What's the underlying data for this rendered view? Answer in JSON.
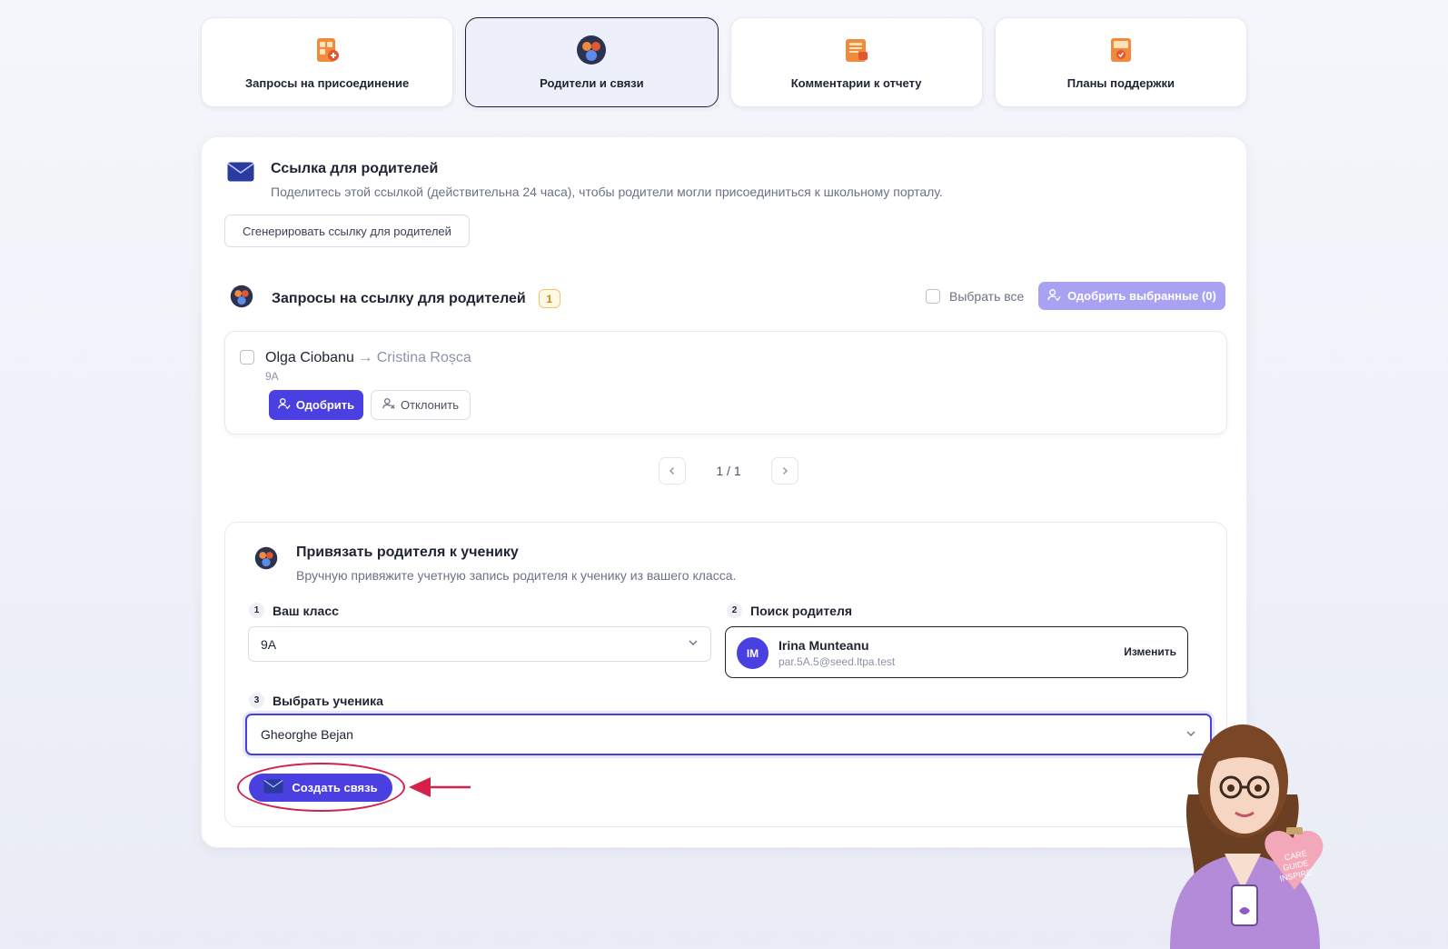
{
  "tabs": [
    {
      "label": "Запросы на присоединение",
      "icon": "join-requests-icon"
    },
    {
      "label": "Родители и связи",
      "icon": "parents-links-icon",
      "active": true
    },
    {
      "label": "Комментарии к отчету",
      "icon": "report-comments-icon"
    },
    {
      "label": "Планы поддержки",
      "icon": "support-plans-icon"
    }
  ],
  "parent_link": {
    "title": "Ссылка для родителей",
    "description": "Поделитесь этой ссылкой (действительна 24 часа), чтобы родители могли присоединиться к школьному порталу.",
    "generate_button": "Сгенерировать ссылку для родителей"
  },
  "requests": {
    "title": "Запросы на ссылку для родителей",
    "count": "1",
    "select_all": "Выбрать все",
    "approve_selected": "Одобрить выбранные (0)",
    "items": [
      {
        "parent": "Olga Ciobanu",
        "arrow": "→",
        "student": "Cristina Roșca",
        "class": "9A",
        "approve": "Одобрить",
        "reject": "Отклонить"
      }
    ],
    "pagination": "1 / 1"
  },
  "link_form": {
    "title": "Привязать родителя к ученику",
    "description": "Вручную привяжите учетную запись родителя к ученику из вашего класса.",
    "step1": {
      "num": "1",
      "label": "Ваш класс",
      "value": "9A"
    },
    "step2": {
      "num": "2",
      "label": "Поиск родителя",
      "initials": "IM",
      "name": "Irina Munteanu",
      "email": "par.5A.5@seed.ltpa.test",
      "change": "Изменить"
    },
    "step3": {
      "num": "3",
      "label": "Выбрать ученика",
      "value": "Gheorghe Bejan"
    },
    "create_button": "Создать связь"
  },
  "mascot": {
    "heart_text": "CARE GUIDE INSPIRE"
  },
  "colors": {
    "accent": "#4a3fe0",
    "accent_light": "#a9a2f2",
    "highlight": "#d4204a",
    "badge": "#f2c46a"
  }
}
